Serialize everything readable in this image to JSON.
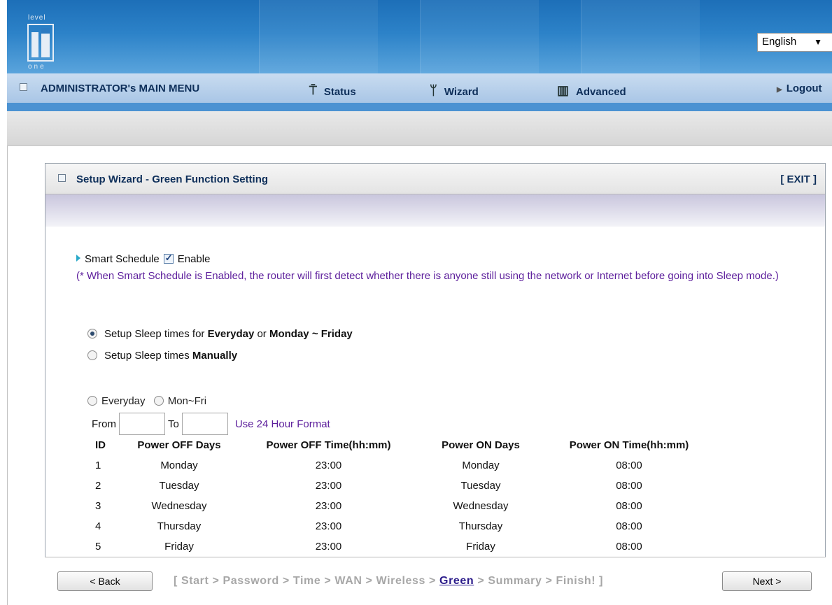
{
  "header": {
    "logo": {
      "top_text": "level",
      "bottom_text": "one"
    },
    "language": {
      "selected": "English"
    }
  },
  "menu": {
    "title": "ADMINISTRATOR's MAIN MENU",
    "items": [
      {
        "label": "Status",
        "icon": "status-person-icon"
      },
      {
        "label": "Wizard",
        "icon": "wizard-icon"
      },
      {
        "label": "Advanced",
        "icon": "advanced-icon"
      }
    ],
    "logout": "Logout"
  },
  "panel": {
    "title": "Setup Wizard - Green Function Setting",
    "exit": "[ EXIT ]"
  },
  "smart_schedule": {
    "label": "Smart Schedule",
    "checkbox_label": "Enable",
    "checked": true,
    "note": "(* When Smart Schedule is Enabled, the router will first detect whether there is anyone still using the network or Internet before going into Sleep mode.)"
  },
  "mode": {
    "option1_prefix": "Setup Sleep times for ",
    "option1_bold1": "Everyday",
    "option1_mid": " or ",
    "option1_bold2": "Monday ~ Friday",
    "option2_prefix": "Setup Sleep times ",
    "option2_bold": "Manually",
    "selected": "option1"
  },
  "schedule_form": {
    "everyday_label": "Everyday",
    "monfri_label": "Mon~Fri",
    "from_label": "From",
    "to_label": "To",
    "from_value": "",
    "to_value": "",
    "format_hint": "Use 24 Hour Format"
  },
  "table": {
    "headers": [
      "ID",
      "Power OFF Days",
      "Power OFF Time(hh:mm)",
      "Power ON Days",
      "Power ON Time(hh:mm)"
    ],
    "rows": [
      [
        "1",
        "Monday",
        "23:00",
        "Monday",
        "08:00"
      ],
      [
        "2",
        "Tuesday",
        "23:00",
        "Tuesday",
        "08:00"
      ],
      [
        "3",
        "Wednesday",
        "23:00",
        "Wednesday",
        "08:00"
      ],
      [
        "4",
        "Thursday",
        "23:00",
        "Thursday",
        "08:00"
      ],
      [
        "5",
        "Friday",
        "23:00",
        "Friday",
        "08:00"
      ]
    ]
  },
  "footer": {
    "back": "< Back",
    "next": "Next >",
    "steps_open": "[ Start > Password > Time > WAN > Wireless > ",
    "steps_current": "Green",
    "steps_close": " > Summary > Finish! ]"
  },
  "colors": {
    "header_blue": "#2c82c8",
    "note_purple": "#5d1f9c",
    "menu_text": "#0e2f5a",
    "current_step": "#2a1a8a"
  }
}
